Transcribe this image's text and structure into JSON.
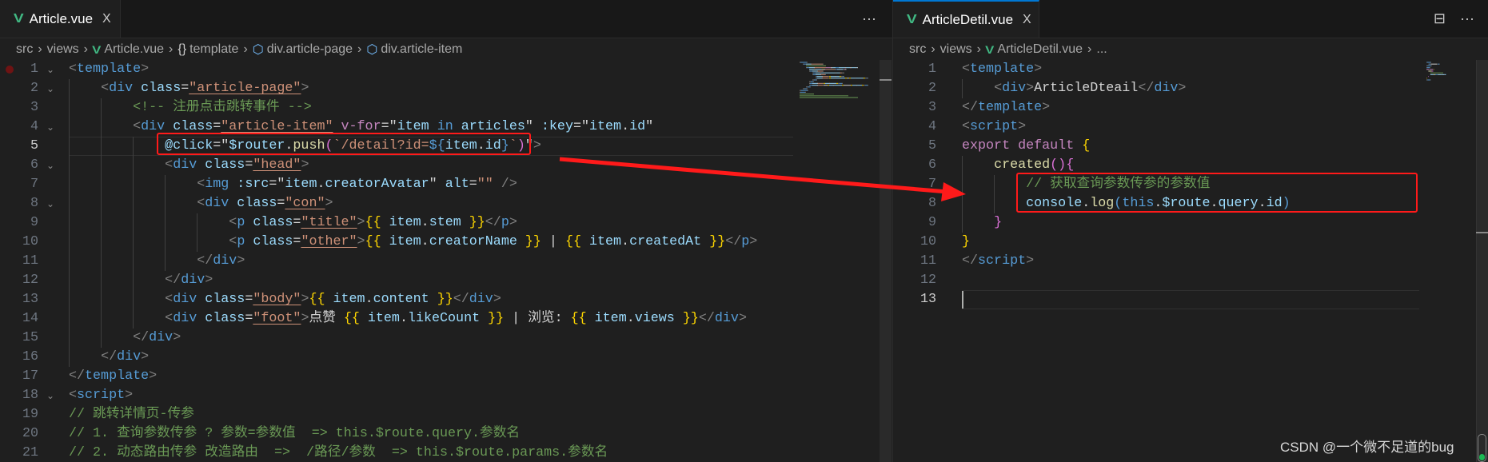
{
  "colors": {
    "accent": "#0078d4",
    "annotation": "#ff1a1a",
    "vue": "#41b883"
  },
  "left": {
    "tab": {
      "icon": "vue-icon",
      "label": "Article.vue",
      "close": "X"
    },
    "more": "···",
    "breadcrumb": [
      {
        "label": "src"
      },
      {
        "label": "views"
      },
      {
        "label": "Article.vue",
        "icon": "vue-icon"
      },
      {
        "label": "template",
        "icon": "braces-icon",
        "glyph": "{}"
      },
      {
        "label": "div.article-page",
        "icon": "cube-icon",
        "glyph": "⬡"
      },
      {
        "label": "div.article-item",
        "icon": "cube-icon",
        "glyph": "⬡"
      }
    ],
    "current_line": 5,
    "breakpoint_line": 1,
    "folds": [
      1,
      2,
      4,
      6,
      8,
      18
    ],
    "lines": [
      [
        [
          "<",
          "p"
        ],
        [
          "template",
          "t"
        ],
        [
          ">",
          "p"
        ]
      ],
      [
        [
          "    ",
          "w"
        ],
        [
          "<",
          "p"
        ],
        [
          "div",
          "t"
        ],
        [
          " class",
          "a"
        ],
        [
          "=",
          "w"
        ],
        [
          "\"article-page\"",
          "s u"
        ],
        [
          ">",
          "p"
        ]
      ],
      [
        [
          "        ",
          "w"
        ],
        [
          "<!-- 注册点击跳转事件 -->",
          "c"
        ]
      ],
      [
        [
          "        ",
          "w"
        ],
        [
          "<",
          "p"
        ],
        [
          "div",
          "t"
        ],
        [
          " class",
          "a"
        ],
        [
          "=",
          "w"
        ],
        [
          "\"article-item\"",
          "s u"
        ],
        [
          " v-for",
          "k"
        ],
        [
          "=",
          "w"
        ],
        [
          "\"",
          "w"
        ],
        [
          "item",
          "v"
        ],
        [
          " in ",
          "b"
        ],
        [
          "articles",
          "v"
        ],
        [
          "\"",
          "w"
        ],
        [
          " :key",
          "a"
        ],
        [
          "=",
          "w"
        ],
        [
          "\"",
          "w"
        ],
        [
          "item",
          "v"
        ],
        [
          ".",
          "w"
        ],
        [
          "id",
          "v"
        ],
        [
          "\"",
          "w"
        ]
      ],
      [
        [
          "            ",
          "w"
        ],
        [
          "@click",
          "a"
        ],
        [
          "=",
          "w"
        ],
        [
          "\"",
          "w"
        ],
        [
          "$router",
          "v"
        ],
        [
          ".",
          "w"
        ],
        [
          "push",
          "f"
        ],
        [
          "(",
          "m"
        ],
        [
          "`/detail?id=",
          "s"
        ],
        [
          "${",
          "b"
        ],
        [
          "item",
          "v"
        ],
        [
          ".",
          "w"
        ],
        [
          "id",
          "v"
        ],
        [
          "}",
          "b"
        ],
        [
          "`",
          "s"
        ],
        [
          ")",
          "m"
        ],
        [
          "\"",
          "w"
        ],
        [
          ">",
          "p"
        ]
      ],
      [
        [
          "            ",
          "w"
        ],
        [
          "<",
          "p"
        ],
        [
          "div",
          "t"
        ],
        [
          " class",
          "a"
        ],
        [
          "=",
          "w"
        ],
        [
          "\"head\"",
          "s u"
        ],
        [
          ">",
          "p"
        ]
      ],
      [
        [
          "                ",
          "w"
        ],
        [
          "<",
          "p"
        ],
        [
          "img",
          "t"
        ],
        [
          " :src",
          "a"
        ],
        [
          "=",
          "w"
        ],
        [
          "\"",
          "w"
        ],
        [
          "item",
          "v"
        ],
        [
          ".",
          "w"
        ],
        [
          "creatorAvatar",
          "v"
        ],
        [
          "\"",
          "w"
        ],
        [
          " alt",
          "a"
        ],
        [
          "=",
          "w"
        ],
        [
          "\"\"",
          "s"
        ],
        [
          " />",
          "p"
        ]
      ],
      [
        [
          "                ",
          "w"
        ],
        [
          "<",
          "p"
        ],
        [
          "div",
          "t"
        ],
        [
          " class",
          "a"
        ],
        [
          "=",
          "w"
        ],
        [
          "\"con\"",
          "s u"
        ],
        [
          ">",
          "p"
        ]
      ],
      [
        [
          "                    ",
          "w"
        ],
        [
          "<",
          "p"
        ],
        [
          "p",
          "t"
        ],
        [
          " class",
          "a"
        ],
        [
          "=",
          "w"
        ],
        [
          "\"title\"",
          "s u"
        ],
        [
          ">",
          "p"
        ],
        [
          "{{",
          "y"
        ],
        [
          " item",
          "v"
        ],
        [
          ".",
          "w"
        ],
        [
          "stem ",
          "v"
        ],
        [
          "}}",
          "y"
        ],
        [
          "</",
          "p"
        ],
        [
          "p",
          "t"
        ],
        [
          ">",
          "p"
        ]
      ],
      [
        [
          "                    ",
          "w"
        ],
        [
          "<",
          "p"
        ],
        [
          "p",
          "t"
        ],
        [
          " class",
          "a"
        ],
        [
          "=",
          "w"
        ],
        [
          "\"other\"",
          "s u"
        ],
        [
          ">",
          "p"
        ],
        [
          "{{",
          "y"
        ],
        [
          " item",
          "v"
        ],
        [
          ".",
          "w"
        ],
        [
          "creatorName ",
          "v"
        ],
        [
          "}}",
          "y"
        ],
        [
          " | ",
          "w"
        ],
        [
          "{{",
          "y"
        ],
        [
          " item",
          "v"
        ],
        [
          ".",
          "w"
        ],
        [
          "createdAt ",
          "v"
        ],
        [
          "}}",
          "y"
        ],
        [
          "</",
          "p"
        ],
        [
          "p",
          "t"
        ],
        [
          ">",
          "p"
        ]
      ],
      [
        [
          "                ",
          "w"
        ],
        [
          "</",
          "p"
        ],
        [
          "div",
          "t"
        ],
        [
          ">",
          "p"
        ]
      ],
      [
        [
          "            ",
          "w"
        ],
        [
          "</",
          "p"
        ],
        [
          "div",
          "t"
        ],
        [
          ">",
          "p"
        ]
      ],
      [
        [
          "            ",
          "w"
        ],
        [
          "<",
          "p"
        ],
        [
          "div",
          "t"
        ],
        [
          " class",
          "a"
        ],
        [
          "=",
          "w"
        ],
        [
          "\"body\"",
          "s u"
        ],
        [
          ">",
          "p"
        ],
        [
          "{{",
          "y"
        ],
        [
          " item",
          "v"
        ],
        [
          ".",
          "w"
        ],
        [
          "content ",
          "v"
        ],
        [
          "}}",
          "y"
        ],
        [
          "</",
          "p"
        ],
        [
          "div",
          "t"
        ],
        [
          ">",
          "p"
        ]
      ],
      [
        [
          "            ",
          "w"
        ],
        [
          "<",
          "p"
        ],
        [
          "div",
          "t"
        ],
        [
          " class",
          "a"
        ],
        [
          "=",
          "w"
        ],
        [
          "\"foot\"",
          "s u"
        ],
        [
          ">",
          "p"
        ],
        [
          "点赞 ",
          "w"
        ],
        [
          "{{",
          "y"
        ],
        [
          " item",
          "v"
        ],
        [
          ".",
          "w"
        ],
        [
          "likeCount ",
          "v"
        ],
        [
          "}}",
          "y"
        ],
        [
          " | 浏览: ",
          "w"
        ],
        [
          "{{",
          "y"
        ],
        [
          " item",
          "v"
        ],
        [
          ".",
          "w"
        ],
        [
          "views ",
          "v"
        ],
        [
          "}}",
          "y"
        ],
        [
          "</",
          "p"
        ],
        [
          "div",
          "t"
        ],
        [
          ">",
          "p"
        ]
      ],
      [
        [
          "        ",
          "w"
        ],
        [
          "</",
          "p"
        ],
        [
          "div",
          "t"
        ],
        [
          ">",
          "p"
        ]
      ],
      [
        [
          "    ",
          "w"
        ],
        [
          "</",
          "p"
        ],
        [
          "div",
          "t"
        ],
        [
          ">",
          "p"
        ]
      ],
      [
        [
          "</",
          "p"
        ],
        [
          "template",
          "t"
        ],
        [
          ">",
          "p"
        ]
      ],
      [
        [
          "<",
          "p"
        ],
        [
          "script",
          "t"
        ],
        [
          ">",
          "p"
        ]
      ],
      [
        [
          "// 跳转详情页-传参",
          "c"
        ]
      ],
      [
        [
          "// 1. 查询参数传参 ? 参数=参数值  => this.$route.query.参数名",
          "c"
        ]
      ],
      [
        [
          "// 2. 动态路由传参 改造路由  =>  /路径/参数  => this.$route.params.参数名",
          "c"
        ]
      ]
    ]
  },
  "right": {
    "tab": {
      "icon": "vue-icon",
      "label": "ArticleDetil.vue",
      "close": "X"
    },
    "split": "⊟",
    "more": "···",
    "breadcrumb": [
      {
        "label": "src"
      },
      {
        "label": "views"
      },
      {
        "label": "ArticleDetil.vue",
        "icon": "vue-icon"
      },
      {
        "label": "..."
      }
    ],
    "current_line": 13,
    "lines": [
      [
        [
          "<",
          "p"
        ],
        [
          "template",
          "t"
        ],
        [
          ">",
          "p"
        ]
      ],
      [
        [
          "    ",
          "w"
        ],
        [
          "<",
          "p"
        ],
        [
          "div",
          "t"
        ],
        [
          ">",
          "p"
        ],
        [
          "ArticleDteail",
          "w"
        ],
        [
          "</",
          "p"
        ],
        [
          "div",
          "t"
        ],
        [
          ">",
          "p"
        ]
      ],
      [
        [
          "</",
          "p"
        ],
        [
          "template",
          "t"
        ],
        [
          ">",
          "p"
        ]
      ],
      [
        [
          "<",
          "p"
        ],
        [
          "script",
          "t"
        ],
        [
          ">",
          "p"
        ]
      ],
      [
        [
          "export",
          "k"
        ],
        [
          " ",
          "w"
        ],
        [
          "default",
          "k"
        ],
        [
          " ",
          "w"
        ],
        [
          "{",
          "y"
        ]
      ],
      [
        [
          "    ",
          "w"
        ],
        [
          "created",
          "f"
        ],
        [
          "()",
          "m"
        ],
        [
          "{",
          "m"
        ]
      ],
      [
        [
          "        ",
          "w"
        ],
        [
          "// 获取查询参数传参的参数值",
          "c"
        ]
      ],
      [
        [
          "        ",
          "w"
        ],
        [
          "console",
          "v"
        ],
        [
          ".",
          "w"
        ],
        [
          "log",
          "f"
        ],
        [
          "(",
          "b"
        ],
        [
          "this",
          "b"
        ],
        [
          ".",
          "w"
        ],
        [
          "$route",
          "v"
        ],
        [
          ".",
          "w"
        ],
        [
          "query",
          "v"
        ],
        [
          ".",
          "w"
        ],
        [
          "id",
          "v"
        ],
        [
          ")",
          "b"
        ]
      ],
      [
        [
          "    ",
          "w"
        ],
        [
          "}",
          "m"
        ]
      ],
      [
        [
          "}",
          "y"
        ]
      ],
      [
        [
          "</",
          "p"
        ],
        [
          "script",
          "t"
        ],
        [
          ">",
          "p"
        ]
      ],
      [],
      []
    ]
  },
  "watermark": "CSDN @一个微不足道的bug"
}
